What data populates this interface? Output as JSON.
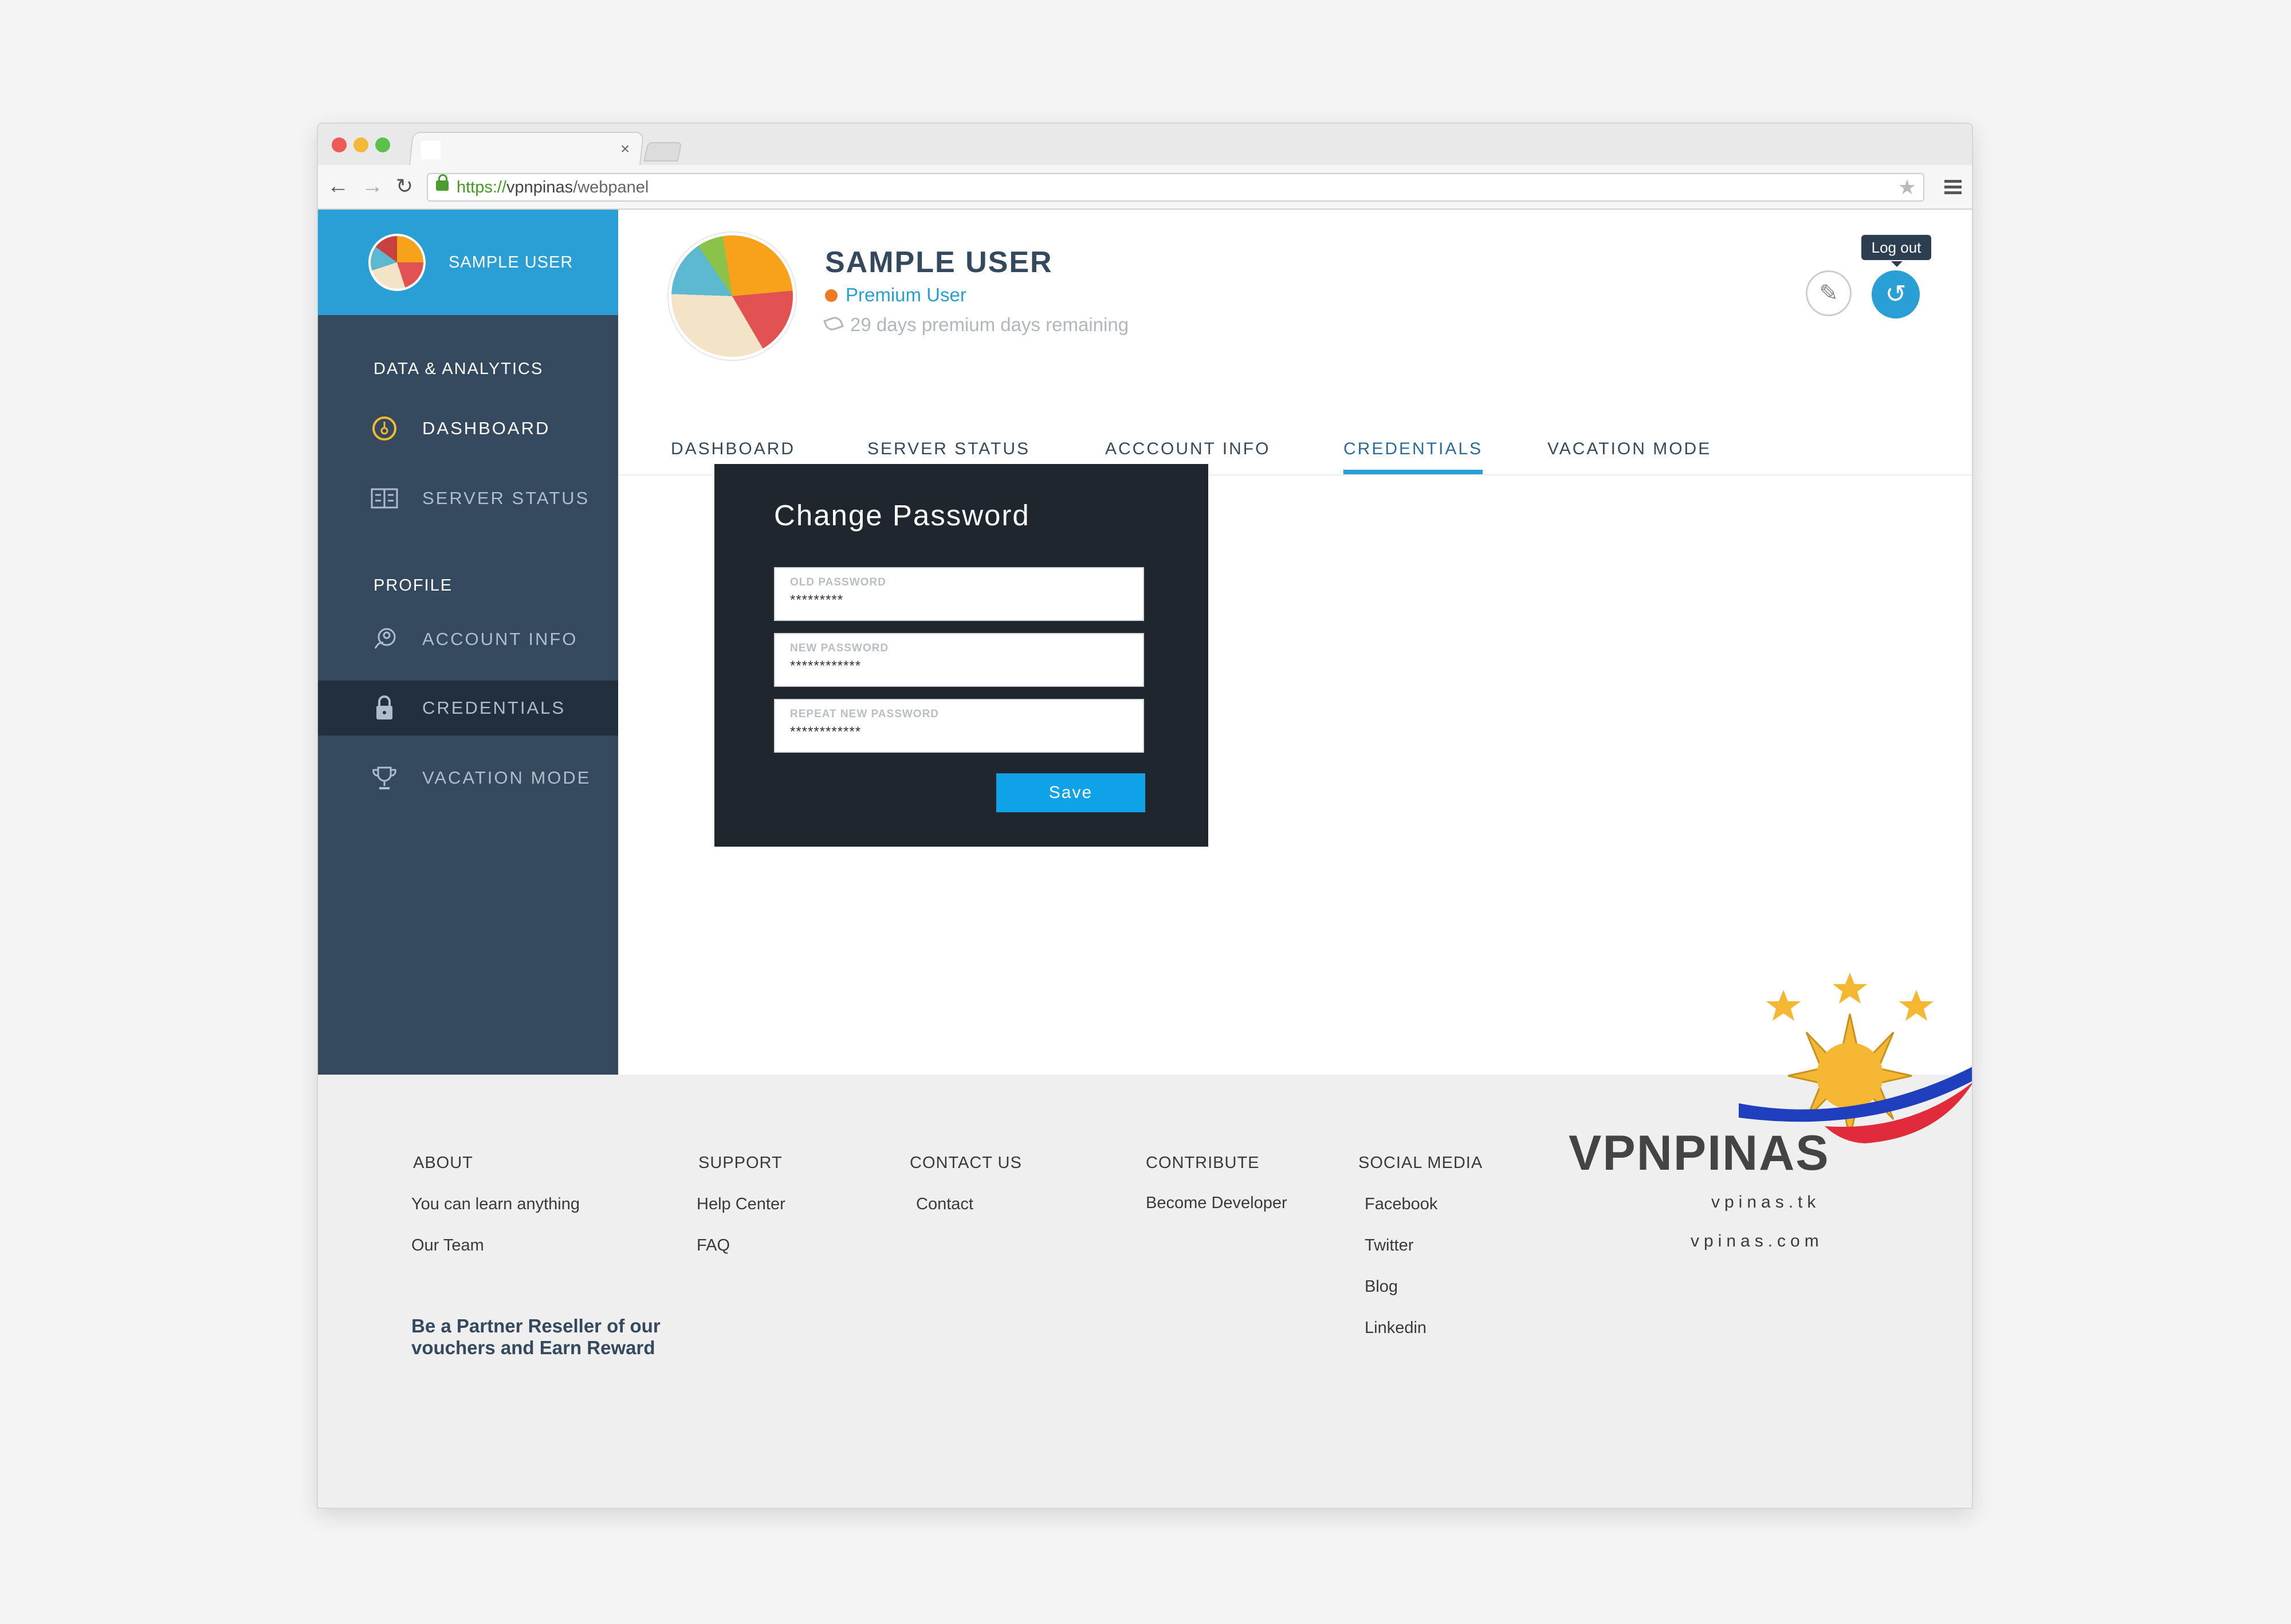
{
  "browser": {
    "tab_close": "×",
    "url_scheme": "https://",
    "url_host": "vpnpinas",
    "url_path": "/webpanel",
    "traffic_lights": [
      "#ee5b55",
      "#f4b83a",
      "#5ac14a"
    ]
  },
  "sidebar": {
    "user": "SAMPLE USER",
    "section_analytics": "DATA & ANALYTICS",
    "section_profile": "PROFILE",
    "items": [
      {
        "label": "DASHBOARD",
        "icon": "dashboard-gauge-icon"
      },
      {
        "label": "SERVER STATUS",
        "icon": "server-icon"
      },
      {
        "label": "ACCOUNT INFO",
        "icon": "account-icon"
      },
      {
        "label": "CREDENTIALS",
        "icon": "lock-icon"
      },
      {
        "label": "VACATION MODE",
        "icon": "trophy-icon"
      }
    ]
  },
  "profile": {
    "name": "SAMPLE USER",
    "plan": "Premium User",
    "days_remaining": "29 days premium days remaining",
    "logout_tooltip": "Log out"
  },
  "tabs": [
    "DASHBOARD",
    "SERVER STATUS",
    "ACCCOUNT INFO",
    "CREDENTIALS",
    "VACATION MODE"
  ],
  "active_tab": "CREDENTIALS",
  "change_password": {
    "title": "Change Password",
    "old_label": "OLD PASSWORD",
    "old_value": "*********",
    "new_label": "NEW PASSWORD",
    "new_value": "************",
    "repeat_label": "REPEAT NEW PASSWORD",
    "repeat_value": "************",
    "save": "Save"
  },
  "footer": {
    "about": {
      "title": "ABOUT",
      "links": [
        "You can learn anything",
        "Our Team"
      ]
    },
    "support": {
      "title": "SUPPORT",
      "links": [
        "Help Center",
        "FAQ"
      ]
    },
    "contact": {
      "title": "CONTACT US",
      "links": [
        "Contact"
      ]
    },
    "contribute": {
      "title": "CONTRIBUTE",
      "links": [
        "Become Developer"
      ]
    },
    "social": {
      "title": "SOCIAL MEDIA",
      "links": [
        "Facebook",
        "Twitter",
        "Blog",
        "Linkedin"
      ]
    },
    "partner_line1": "Be a Partner Reseller of our",
    "partner_line2": "vouchers and Earn Reward",
    "brand": "VPNPINAS",
    "domains": [
      "vpinas.tk",
      "vpinas.com"
    ]
  },
  "colors": {
    "sidebar": "#34495e",
    "accent": "#2a9fd6",
    "card": "#1f262e",
    "save": "#0fa2e8",
    "premium_dot": "#ee7a22"
  }
}
